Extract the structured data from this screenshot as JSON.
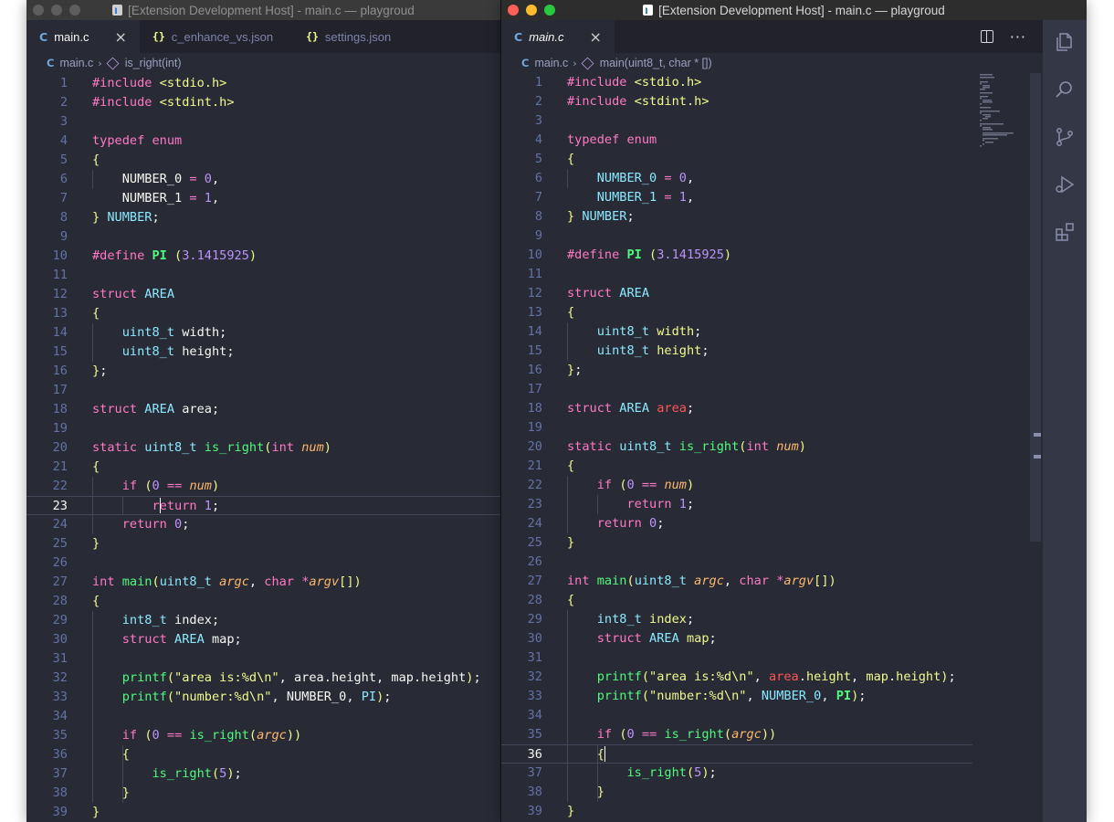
{
  "left_window": {
    "title": "[Extension Development Host] - main.c — playgroud",
    "tabs": [
      {
        "icon": "C",
        "label": "main.c",
        "active": true,
        "close": "×"
      },
      {
        "icon": "{}",
        "label": "c_enhance_vs.json",
        "active": false
      },
      {
        "icon": "{}",
        "label": "settings.json",
        "active": false
      }
    ],
    "breadcrumb": {
      "file": "main.c",
      "symbol": "is_right(int)",
      "sep": "›"
    },
    "current_line": 23,
    "visible_lines": [
      1,
      39
    ]
  },
  "right_window": {
    "title": "[Extension Development Host] - main.c — playgroud",
    "tabs": [
      {
        "icon": "C",
        "label": "main.c",
        "active": true,
        "close": "×"
      }
    ],
    "breadcrumb": {
      "file": "main.c",
      "symbol": "main(uint8_t, char * [])",
      "sep": "›"
    },
    "current_line": 36,
    "visible_lines": [
      1,
      39
    ],
    "activity_bar": [
      "files-icon",
      "search-icon",
      "source-control-icon",
      "run-debug-icon",
      "extensions-icon"
    ],
    "editor_actions": [
      "split-editor-icon",
      "more-actions-icon"
    ]
  },
  "code_lines": [
    "#include <stdio.h>",
    "#include <stdint.h>",
    "",
    "typedef enum",
    "{",
    "    NUMBER_0 = 0,",
    "    NUMBER_1 = 1,",
    "} NUMBER;",
    "",
    "#define PI (3.1415925)",
    "",
    "struct AREA",
    "{",
    "    uint8_t width;",
    "    uint8_t height;",
    "};",
    "",
    "struct AREA area;",
    "",
    "static uint8_t is_right(int num)",
    "{",
    "    if (0 == num)",
    "        return 1;",
    "    return 0;",
    "}",
    "",
    "int main(uint8_t argc, char *argv[])",
    "{",
    "    int8_t index;",
    "    struct AREA map;",
    "",
    "    printf(\"area is:%d\\n\", area.height, map.height);",
    "    printf(\"number:%d\\n\", NUMBER_0, PI);",
    "",
    "    if (0 == is_right(argc))",
    "    {",
    "        is_right(5);",
    "    }",
    "}"
  ],
  "colors": {
    "background": "#282a36",
    "keyword": "#ff79c6",
    "type": "#8be9fd",
    "string": "#f1fa8c",
    "function": "#50fa7b",
    "number": "#bd93f9",
    "parameter": "#ffb86c",
    "line_number": "#6272a4",
    "enhanced_global": "#ff5555",
    "enhanced_field": "#f1fa8c"
  }
}
